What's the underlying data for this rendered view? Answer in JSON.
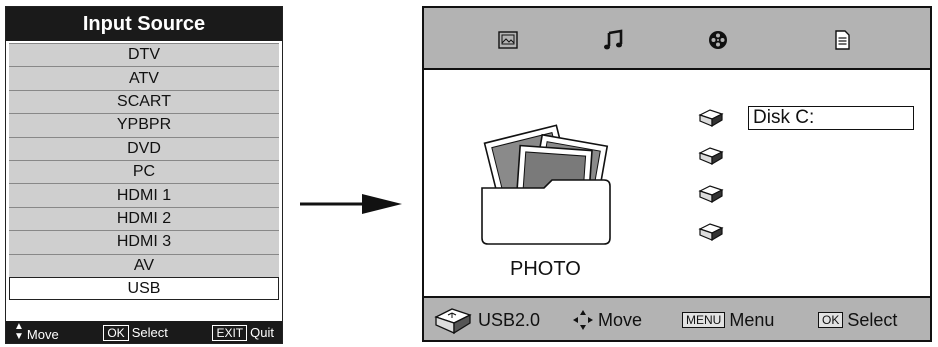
{
  "input_source": {
    "title": "Input Source",
    "items": [
      {
        "label": "DTV"
      },
      {
        "label": "ATV"
      },
      {
        "label": "SCART"
      },
      {
        "label": "YPBPR"
      },
      {
        "label": "DVD"
      },
      {
        "label": "PC"
      },
      {
        "label": "HDMI 1"
      },
      {
        "label": "HDMI 2"
      },
      {
        "label": "HDMI 3"
      },
      {
        "label": "AV"
      },
      {
        "label": "USB",
        "selected": true
      }
    ],
    "footer": {
      "move_label": "Move",
      "ok_key": "OK",
      "select_label": "Select",
      "exit_key": "EXIT",
      "quit_label": "Quit"
    }
  },
  "usb_browser": {
    "tabs": [
      "photo-tab-icon",
      "music-tab-icon",
      "movie-tab-icon",
      "text-tab-icon"
    ],
    "photo_label": "PHOTO",
    "disks": [
      {
        "label": "Disk C:",
        "selected": true
      },
      {
        "label": ""
      },
      {
        "label": ""
      },
      {
        "label": ""
      }
    ],
    "bottom_bar": {
      "usb_label": "USB2.0",
      "move_label": "Move",
      "menu_key": "MENU",
      "menu_label": "Menu",
      "ok_key": "OK",
      "select_label": "Select"
    }
  },
  "colors": {
    "bar_gray": "#b3b3b3",
    "item_gray": "#cfcfcf",
    "dark": "#1a1a1a"
  }
}
